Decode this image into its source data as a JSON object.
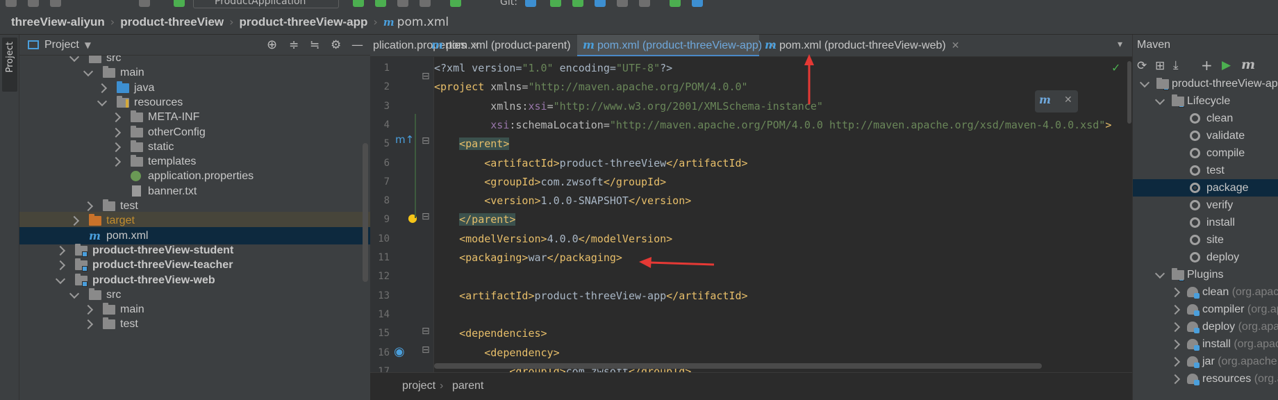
{
  "toolbar": {
    "run_config": "ProductApplication",
    "git_label": "Git:"
  },
  "breadcrumb": [
    "threeView-aliyun",
    "product-threeView",
    "product-threeView-app",
    "pom.xml"
  ],
  "left_strip": {
    "project_tab": "Project"
  },
  "project_panel": {
    "title": "Project",
    "tree": [
      {
        "label": "src",
        "indent": 1,
        "expanded": true,
        "icon": "folder"
      },
      {
        "label": "main",
        "indent": 2,
        "expanded": true,
        "icon": "folder"
      },
      {
        "label": "java",
        "indent": 3,
        "expanded": false,
        "icon": "folder-blue"
      },
      {
        "label": "resources",
        "indent": 3,
        "expanded": true,
        "icon": "folder-resources"
      },
      {
        "label": "META-INF",
        "indent": 4,
        "expanded": false,
        "icon": "folder"
      },
      {
        "label": "otherConfig",
        "indent": 4,
        "expanded": false,
        "icon": "folder"
      },
      {
        "label": "static",
        "indent": 4,
        "expanded": false,
        "icon": "folder"
      },
      {
        "label": "templates",
        "indent": 4,
        "expanded": false,
        "icon": "folder"
      },
      {
        "label": "application.properties",
        "indent": 4,
        "leaf": true,
        "icon": "spring-properties-icon"
      },
      {
        "label": "banner.txt",
        "indent": 4,
        "leaf": true,
        "icon": "text-file-icon"
      },
      {
        "label": "test",
        "indent": 2,
        "expanded": false,
        "icon": "folder"
      },
      {
        "label": "target",
        "indent": 1,
        "expanded": false,
        "icon": "folder-orange",
        "state": "target"
      },
      {
        "label": "pom.xml",
        "indent": 1,
        "leaf": true,
        "icon": "maven-icon",
        "state": "selected"
      },
      {
        "label": "product-threeView-student",
        "indent": 0,
        "expanded": false,
        "icon": "module",
        "bold": true
      },
      {
        "label": "product-threeView-teacher",
        "indent": 0,
        "expanded": false,
        "icon": "module",
        "bold": true
      },
      {
        "label": "product-threeView-web",
        "indent": 0,
        "expanded": true,
        "icon": "module",
        "bold": true
      },
      {
        "label": "src",
        "indent": 1,
        "expanded": true,
        "icon": "folder"
      },
      {
        "label": "main",
        "indent": 2,
        "expanded": false,
        "icon": "folder"
      },
      {
        "label": "test",
        "indent": 2,
        "expanded": false,
        "icon": "folder"
      }
    ]
  },
  "editor_tabs": [
    {
      "label": "plication.properties",
      "icon": "",
      "active": false
    },
    {
      "label": "pom.xml (product-parent)",
      "icon": "m",
      "active": false
    },
    {
      "label": "pom.xml (product-threeView-app)",
      "icon": "m",
      "active": true
    },
    {
      "label": "pom.xml (product-threeView-web)",
      "icon": "m",
      "active": false
    }
  ],
  "code_lines": [
    {
      "n": "1",
      "html": "<span class='txt'>&lt;?xml version=</span><span class='str'>\"1.0\"</span><span class='txt'> encoding=</span><span class='str'>\"UTF-8\"</span><span class='txt'>?&gt;</span>"
    },
    {
      "n": "2",
      "html": "<span class='tag'>&lt;project </span><span class='attr'>xmlns=</span><span class='str'>\"http://maven.apache.org/POM/4.0.0\"</span>"
    },
    {
      "n": "3",
      "html": "         <span class='attr'>xmlns:</span><span class='ns'>xsi</span><span class='attr'>=</span><span class='str'>\"http://www.w3.org/2001/XMLSchema-instance\"</span>"
    },
    {
      "n": "4",
      "html": "         <span class='ns'>xsi</span><span class='attr'>:schemaLocation=</span><span class='str'>\"http://maven.apache.org/POM/4.0.0 http://maven.apache.org/xsd/maven-4.0.0.xsd\"</span><span class='tag'>&gt;</span>"
    },
    {
      "n": "5",
      "html": "    <span class='tag hl'>&lt;parent&gt;</span>"
    },
    {
      "n": "6",
      "html": "        <span class='tag'>&lt;artifactId&gt;</span><span class='txt'>product-threeView</span><span class='tag'>&lt;/artifactId&gt;</span>"
    },
    {
      "n": "7",
      "html": "        <span class='tag'>&lt;groupId&gt;</span><span class='txt'>com.zwsoft</span><span class='tag'>&lt;/groupId&gt;</span>"
    },
    {
      "n": "8",
      "html": "        <span class='tag'>&lt;version&gt;</span><span class='txt'>1.0.0-SNAPSHOT</span><span class='tag'>&lt;/version&gt;</span>"
    },
    {
      "n": "9",
      "html": "    <span class='tag hl'>&lt;/parent&gt;</span>"
    },
    {
      "n": "10",
      "html": "    <span class='tag'>&lt;modelVersion&gt;</span><span class='txt'>4.0.0</span><span class='tag'>&lt;/modelVersion&gt;</span>"
    },
    {
      "n": "11",
      "html": "    <span class='tag'>&lt;packaging&gt;</span><span class='txt'>war</span><span class='tag'>&lt;/packaging&gt;</span>"
    },
    {
      "n": "12",
      "html": ""
    },
    {
      "n": "13",
      "html": "    <span class='tag'>&lt;artifactId&gt;</span><span class='txt'>product-threeView-app</span><span class='tag'>&lt;/artifactId&gt;</span>"
    },
    {
      "n": "14",
      "html": ""
    },
    {
      "n": "15",
      "html": "    <span class='tag'>&lt;dependencies&gt;</span>"
    },
    {
      "n": "16",
      "html": "        <span class='tag'>&lt;dependency&gt;</span>"
    },
    {
      "n": "17",
      "html": "            <span class='tag'>&lt;groupId&gt;</span><span class='txt'>com.zwsoft</span><span class='tag'>&lt;/groupId&gt;</span>"
    }
  ],
  "status_crumb": [
    "project",
    "parent"
  ],
  "maven": {
    "title": "Maven",
    "tree": [
      {
        "label": "product-threeView-app",
        "indent": 0,
        "icon": "maven-module",
        "expanded": true
      },
      {
        "label": "Lifecycle",
        "indent": 1,
        "icon": "lifecycle",
        "expanded": true
      },
      {
        "label": "clean",
        "indent": 2,
        "icon": "gear"
      },
      {
        "label": "validate",
        "indent": 2,
        "icon": "gear"
      },
      {
        "label": "compile",
        "indent": 2,
        "icon": "gear"
      },
      {
        "label": "test",
        "indent": 2,
        "icon": "gear"
      },
      {
        "label": "package",
        "indent": 2,
        "icon": "gear",
        "selected": true
      },
      {
        "label": "verify",
        "indent": 2,
        "icon": "gear"
      },
      {
        "label": "install",
        "indent": 2,
        "icon": "gear"
      },
      {
        "label": "site",
        "indent": 2,
        "icon": "gear"
      },
      {
        "label": "deploy",
        "indent": 2,
        "icon": "gear"
      },
      {
        "label": "Plugins",
        "indent": 1,
        "icon": "plugins",
        "expanded": true
      },
      {
        "label": "clean",
        "suffix": " (org.apache.maven.plugins)",
        "indent": 2,
        "icon": "plugin",
        "expanded": false
      },
      {
        "label": "compiler",
        "suffix": " (org.apache.maven.plugins)",
        "indent": 2,
        "icon": "plugin",
        "expanded": false
      },
      {
        "label": "deploy",
        "suffix": " (org.apache.maven.plugins)",
        "indent": 2,
        "icon": "plugin",
        "expanded": false
      },
      {
        "label": "install",
        "suffix": " (org.apache.maven.plugins)",
        "indent": 2,
        "icon": "plugin",
        "expanded": false
      },
      {
        "label": "jar",
        "suffix": " (org.apache.maven.plugins)",
        "indent": 2,
        "icon": "plugin",
        "expanded": false
      },
      {
        "label": "resources",
        "suffix": " (org.apache.maven.plugins)",
        "indent": 2,
        "icon": "plugin",
        "expanded": false
      }
    ]
  },
  "colors": {
    "accent": "#4a88c7",
    "annotation_arrow": "#e53935",
    "selection": "#0d293e"
  }
}
